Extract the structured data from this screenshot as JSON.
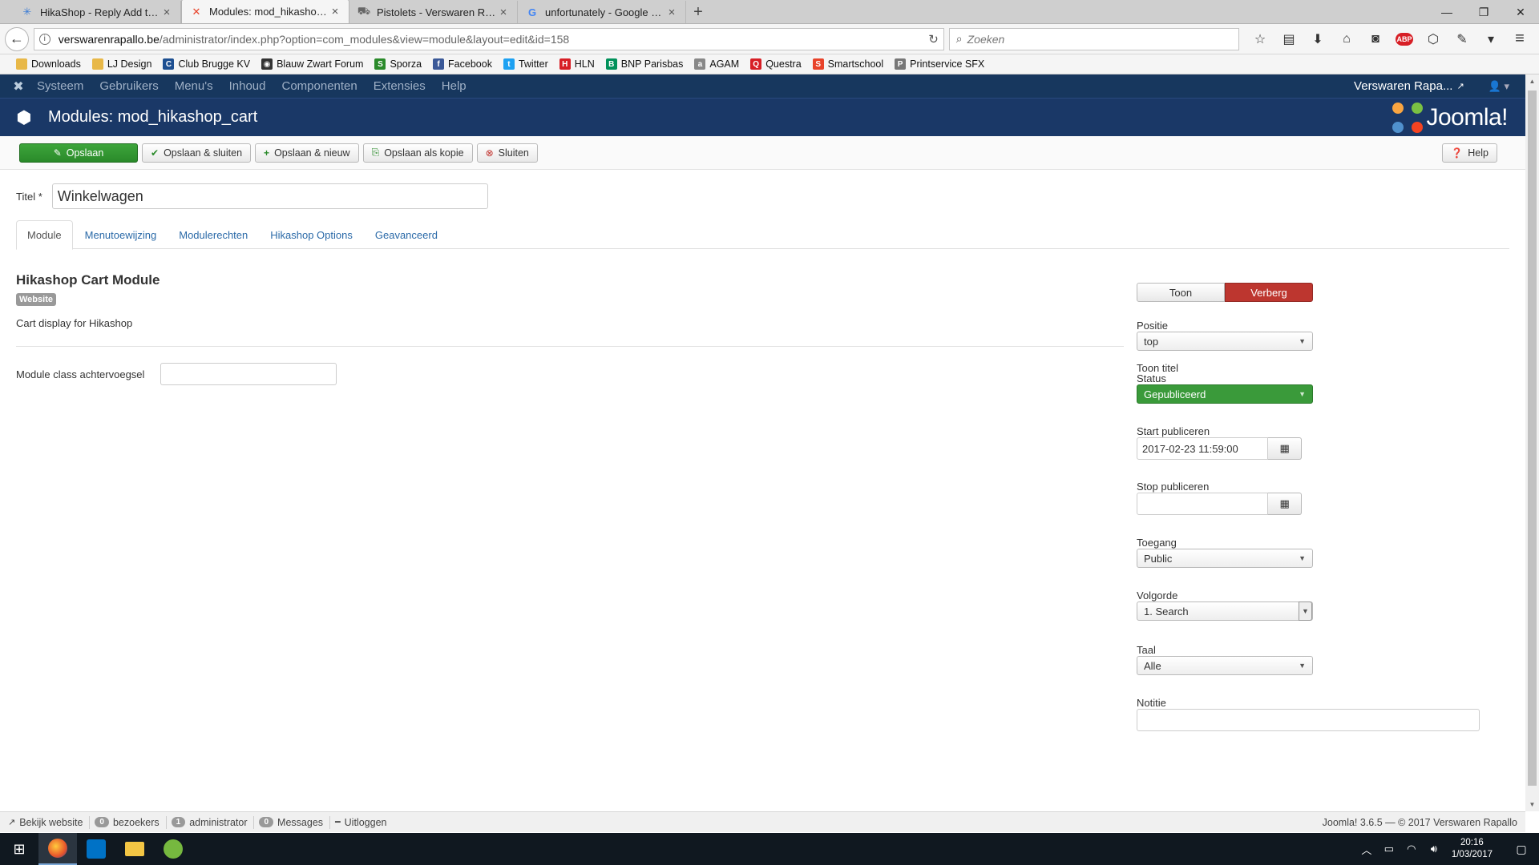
{
  "browser": {
    "tabs": [
      {
        "label": "HikaShop - Reply Add to c...",
        "icon": "hikashop-star-icon",
        "active": false
      },
      {
        "label": "Modules: mod_hikashop_...",
        "icon": "joomla-favicon-icon",
        "active": true
      },
      {
        "label": "Pistolets - Verswaren Rapa...",
        "icon": "cart-favicon-icon",
        "active": false
      },
      {
        "label": "unfortunately - Google zo...",
        "icon": "google-favicon-icon",
        "active": false
      }
    ],
    "url_host": "verswarenrapallo.be",
    "url_path": "/administrator/index.php?option=com_modules&view=module&layout=edit&id=158",
    "search_placeholder": "Zoeken",
    "bookmarks": [
      {
        "label": "Downloads",
        "icon": "folder-icon",
        "color": "#e8b848"
      },
      {
        "label": "LJ Design",
        "icon": "folder-icon",
        "color": "#e8b848"
      },
      {
        "label": "Club Brugge KV",
        "icon": "club-brugge-icon",
        "color": "#1d4f91"
      },
      {
        "label": "Blauw Zwart Forum",
        "icon": "forum-icon",
        "color": "#333333"
      },
      {
        "label": "Sporza",
        "icon": "sporza-icon",
        "color": "#2a8a2a"
      },
      {
        "label": "Facebook",
        "icon": "facebook-icon",
        "color": "#3b5998"
      },
      {
        "label": "Twitter",
        "icon": "twitter-icon",
        "color": "#1da1f2"
      },
      {
        "label": "HLN",
        "icon": "hln-icon",
        "color": "#d71f26"
      },
      {
        "label": "BNP Parisbas",
        "icon": "bnp-icon",
        "color": "#00915a"
      },
      {
        "label": "AGAM",
        "icon": "agam-icon",
        "color": "#888888"
      },
      {
        "label": "Questra",
        "icon": "questra-icon",
        "color": "#d71f26"
      },
      {
        "label": "Smartschool",
        "icon": "smartschool-icon",
        "color": "#e8432a"
      },
      {
        "label": "Printservice SFX",
        "icon": "printservice-icon",
        "color": "#777777"
      }
    ]
  },
  "joomla": {
    "menu": [
      "Systeem",
      "Gebruikers",
      "Menu's",
      "Inhoud",
      "Componenten",
      "Extensies",
      "Help"
    ],
    "site_name": "Verswaren Rapa...",
    "page_title": "Modules: mod_hikashop_cart",
    "brand": "Joomla!",
    "toolbar": {
      "save": "Opslaan",
      "save_close": "Opslaan & sluiten",
      "save_new": "Opslaan & nieuw",
      "save_copy": "Opslaan als kopie",
      "close": "Sluiten",
      "help": "Help"
    },
    "title_label": "Titel *",
    "title_value": "Winkelwagen",
    "tabs": [
      "Module",
      "Menutoewijzing",
      "Modulerechten",
      "Hikashop Options",
      "Geavanceerd"
    ],
    "module": {
      "name": "Hikashop Cart Module",
      "badge": "Website",
      "description": "Cart display for Hikashop",
      "class_suffix_label": "Module class achtervoegsel"
    },
    "sidebar": {
      "show_title_label": "Toon titel",
      "show_option": "Toon",
      "hide_option": "Verberg",
      "position_label": "Positie",
      "position_value": "top",
      "status_label": "Status",
      "status_value": "Gepubliceerd",
      "start_label": "Start publiceren",
      "start_value": "2017-02-23 11:59:00",
      "stop_label": "Stop publiceren",
      "access_label": "Toegang",
      "access_value": "Public",
      "order_label": "Volgorde",
      "order_value": "1. Search",
      "language_label": "Taal",
      "language_value": "Alle",
      "note_label": "Notitie"
    },
    "status": {
      "view_site": "Bekijk website",
      "visitors_count": "0",
      "visitors_label": "bezoekers",
      "admin_count": "1",
      "admin_label": "administrator",
      "messages_count": "0",
      "messages_label": "Messages",
      "logout": "Uitloggen",
      "copyright": "Joomla! 3.6.5 — © 2017 Verswaren Rapallo"
    }
  },
  "taskbar": {
    "time": "20:16",
    "date": "1/03/2017"
  },
  "colors": {
    "joomla_navy": "#17375e",
    "save_green": "#2a8a2a",
    "hide_red": "#bd362f",
    "published_green": "#3a9a3a"
  }
}
